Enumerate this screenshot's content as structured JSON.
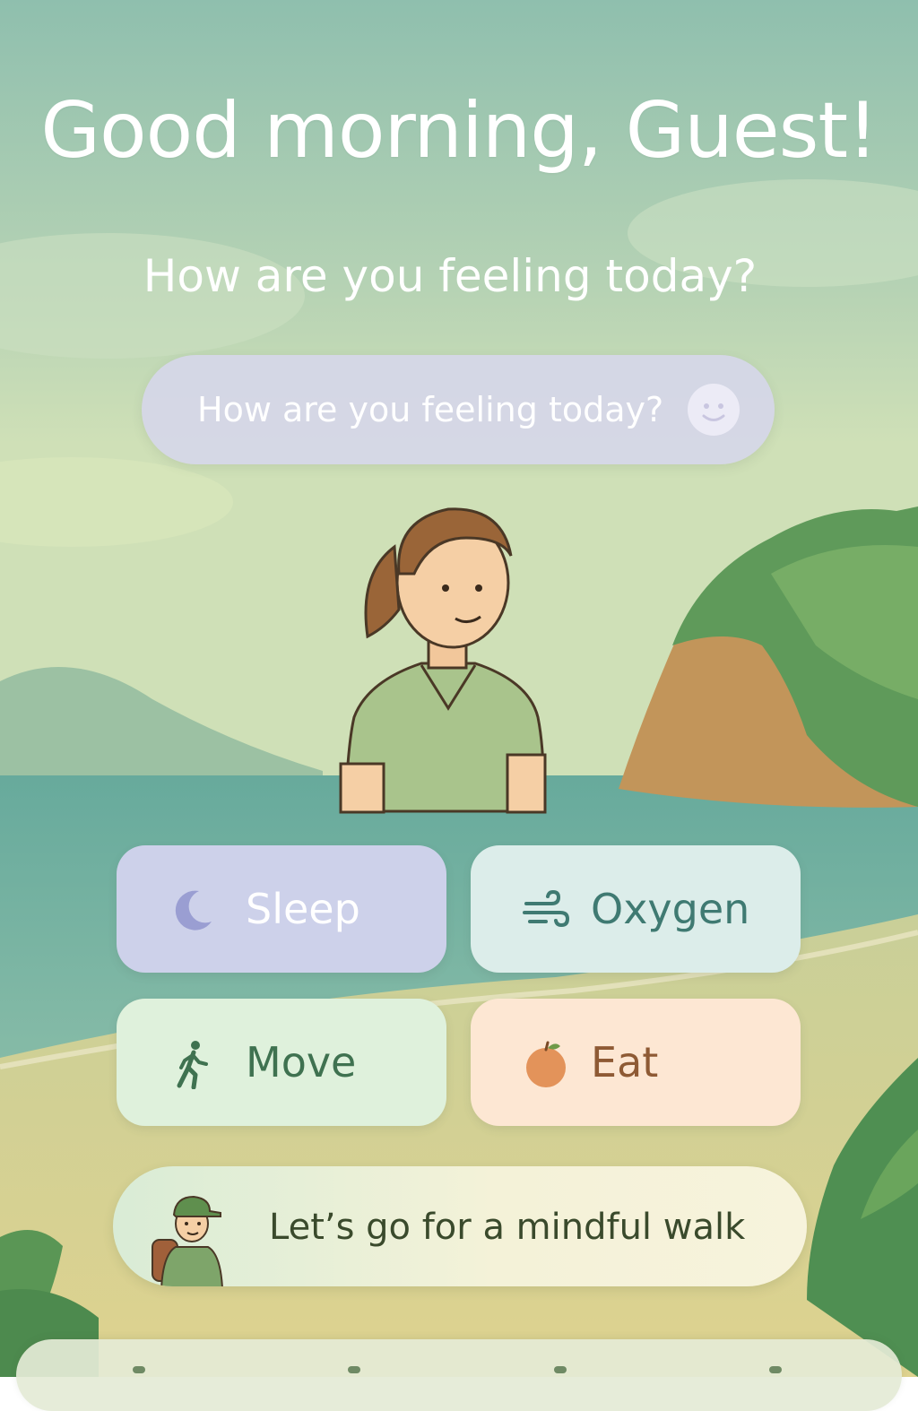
{
  "header": {
    "greeting": "Good morning, Guest!",
    "subtitle": "How are you feeling today?"
  },
  "mood_input": {
    "placeholder": "How are you feeling today?",
    "icon": "smiley-face-icon"
  },
  "categories": [
    {
      "label": "Sleep",
      "icon": "moon-icon",
      "bg": "#cdd1ea"
    },
    {
      "label": "Oxygen",
      "icon": "wind-icon",
      "bg": "#dcedea"
    },
    {
      "label": "Move",
      "icon": "walking-person-icon",
      "bg": "#dff1dc"
    },
    {
      "label": "Eat",
      "icon": "apple-icon",
      "bg": "#fde7d3"
    }
  ],
  "walk_prompt": {
    "label": "Let’s go for a mindful walk",
    "icon": "hiker-icon"
  },
  "colors": {
    "sky_top": "#8fbfae",
    "sea": "#6fb0a2",
    "sand": "#d8cf96",
    "foliage": "#5e9a58"
  }
}
